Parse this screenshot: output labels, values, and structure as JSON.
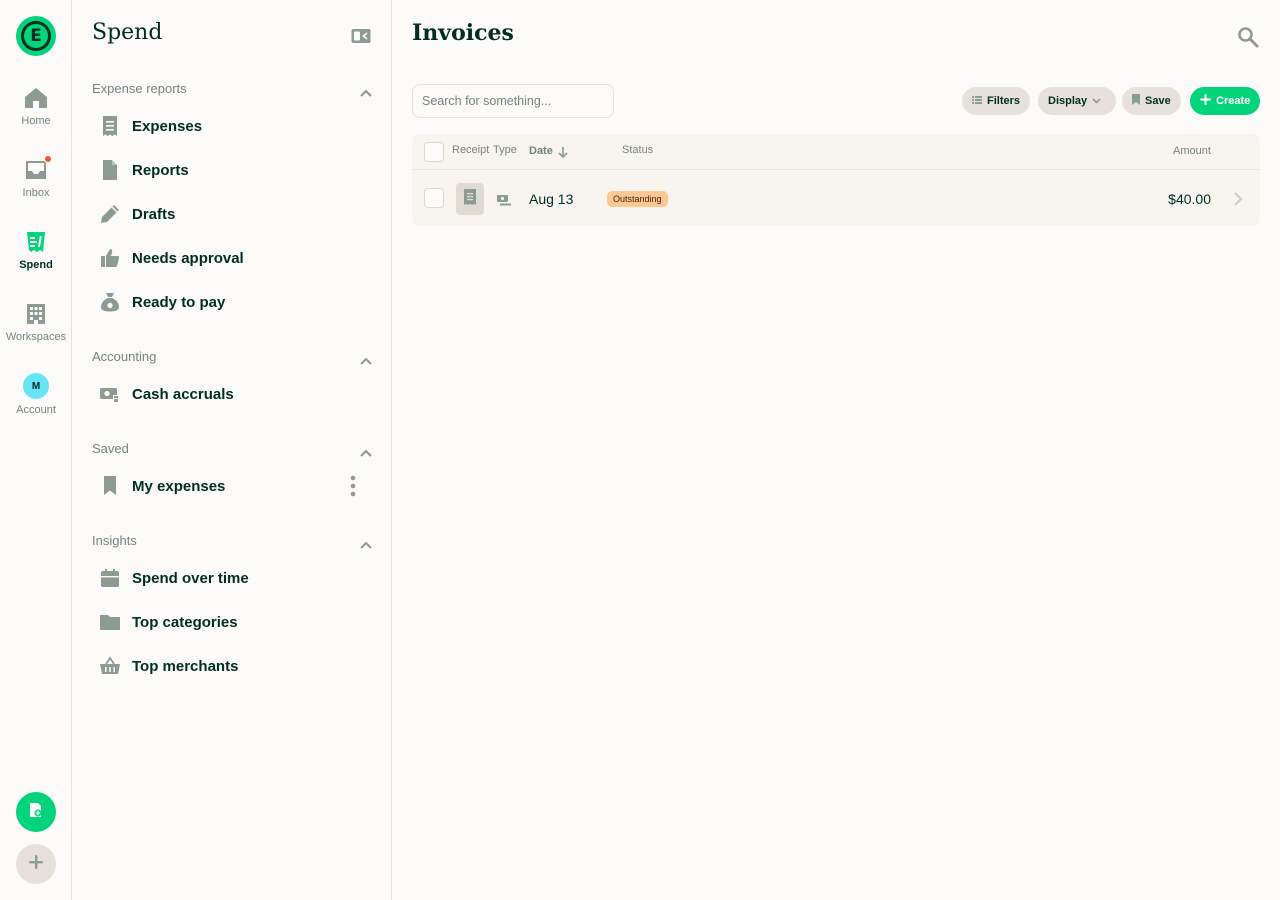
{
  "app": {
    "logo_letter": "E",
    "accent_color": "#03d47c",
    "text_color": "#002e22",
    "muted_color": "#76847e"
  },
  "rail": {
    "items": [
      {
        "label": "Home",
        "icon": "home-icon"
      },
      {
        "label": "Inbox",
        "icon": "inbox-icon",
        "has_notification": true
      },
      {
        "label": "Spend",
        "icon": "receipt-icon",
        "active": true
      },
      {
        "label": "Workspaces",
        "icon": "building-icon"
      },
      {
        "label": "Account",
        "icon": "avatar",
        "avatar_initial": "M"
      }
    ],
    "fab_primary_icon": "new-expense-icon",
    "fab_secondary_icon": "plus-icon"
  },
  "sidebar": {
    "title": "Spend",
    "sections": [
      {
        "label": "Expense reports",
        "items": [
          {
            "label": "Expenses",
            "icon": "receipt-icon"
          },
          {
            "label": "Reports",
            "icon": "document-icon"
          },
          {
            "label": "Drafts",
            "icon": "pencil-icon"
          },
          {
            "label": "Needs approval",
            "icon": "thumbs-up-icon"
          },
          {
            "label": "Ready to pay",
            "icon": "money-bag-icon"
          }
        ]
      },
      {
        "label": "Accounting",
        "items": [
          {
            "label": "Cash accruals",
            "icon": "cash-icon"
          }
        ]
      },
      {
        "label": "Saved",
        "items": [
          {
            "label": "My expenses",
            "icon": "bookmark-icon"
          }
        ]
      },
      {
        "label": "Insights",
        "items": [
          {
            "label": "Spend over time",
            "icon": "calendar-icon"
          },
          {
            "label": "Top categories",
            "icon": "folder-icon"
          },
          {
            "label": "Top merchants",
            "icon": "basket-icon"
          }
        ]
      }
    ]
  },
  "main": {
    "title": "Invoices",
    "search": {
      "placeholder": "Search for something..."
    },
    "toolbar": {
      "filters_label": "Filters",
      "display_label": "Display",
      "save_label": "Save",
      "create_label": "Create"
    },
    "table": {
      "columns": {
        "receipt": "Receipt",
        "type": "Type",
        "date": "Date",
        "status": "Status",
        "amount": "Amount"
      },
      "rows": [
        {
          "date": "Aug 13",
          "status": "Outstanding",
          "amount": "$40.00"
        }
      ]
    }
  }
}
